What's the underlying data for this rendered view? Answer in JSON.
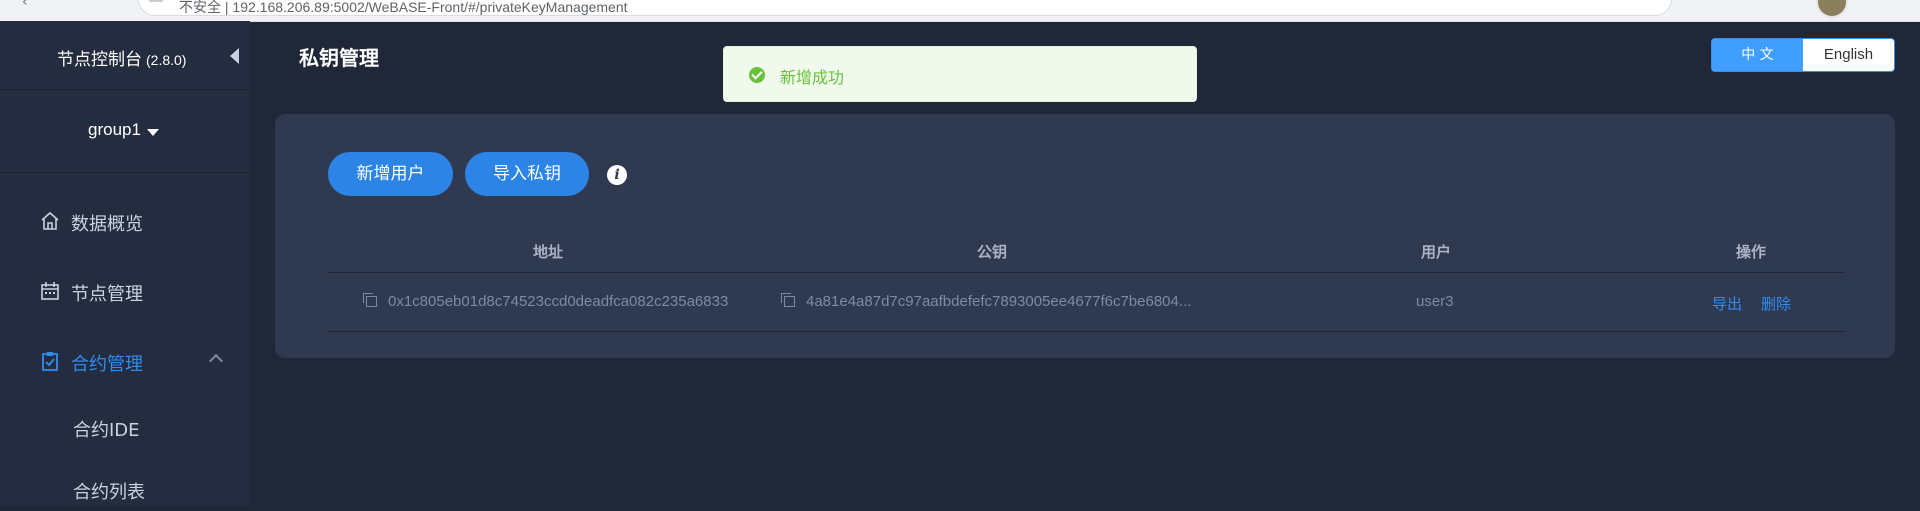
{
  "browser": {
    "url_text": "不安全 | 192.168.206.89:5002/WeBASE-Front/#/privateKeyManagement"
  },
  "sidebar": {
    "app_title": "节点控制台",
    "app_version": "(2.8.0)",
    "group": "group1",
    "items": [
      {
        "label": "数据概览",
        "icon": "home-icon"
      },
      {
        "label": "节点管理",
        "icon": "calendar-icon"
      },
      {
        "label": "合约管理",
        "icon": "clipboard-check-icon",
        "active": true,
        "expanded": true
      }
    ],
    "sub_items": [
      {
        "label": "合约IDE"
      },
      {
        "label": "合约列表"
      }
    ]
  },
  "header": {
    "title": "私钥管理",
    "lang": {
      "zh": "中 文",
      "en": "English",
      "active": "zh"
    }
  },
  "toast": {
    "text": "新增成功",
    "type": "success"
  },
  "toolbar": {
    "add_user": "新增用户",
    "import_key": "导入私钥",
    "info_icon": "i"
  },
  "table": {
    "columns": [
      "地址",
      "公钥",
      "用户",
      "操作"
    ],
    "rows": [
      {
        "address": "0x1c805eb01d8c74523ccd0deadfca082c235a6833",
        "public_key": "4a81e4a87d7c97aafbdefefc7893005ee4677f6c7be6804...",
        "user": "user3",
        "actions": [
          "导出",
          "删除"
        ]
      }
    ]
  },
  "colors": {
    "background": "#1f2738",
    "sidebar": "#242d3f",
    "card": "#2f3a51",
    "primary": "#2b84e6",
    "link": "#2f8cf0",
    "success": "#67c23a"
  }
}
